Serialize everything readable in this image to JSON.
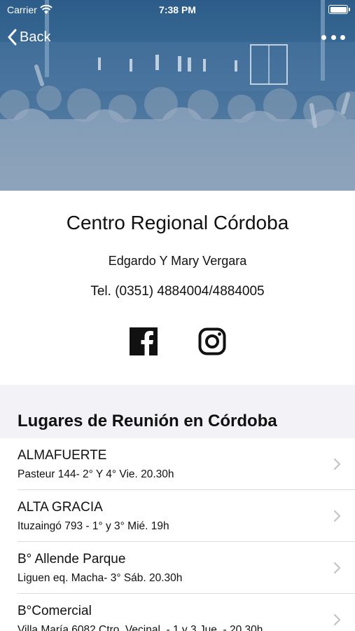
{
  "status_bar": {
    "carrier": "Carrier",
    "time": "7:38 PM"
  },
  "nav": {
    "back_label": "Back"
  },
  "church": {
    "name": "Centro Regional Córdoba",
    "pastors": "Edgardo Y Mary Vergara",
    "phone": "Tel. (0351) 4884004/4884005"
  },
  "social": {
    "facebook_icon": "facebook-icon",
    "instagram_icon": "instagram-icon"
  },
  "section": {
    "title": "Lugares de Reunión en Córdoba"
  },
  "meeting_places": [
    {
      "name": "ALMAFUERTE",
      "detail": "Pasteur 144- 2° Y 4° Vie. 20.30h"
    },
    {
      "name": "ALTA GRACIA",
      "detail": "Ituzaingó 793 - 1° y 3° Mié. 19h"
    },
    {
      "name": "B° Allende Parque",
      "detail": "Liguen eq. Macha- 3° Sáb. 20.30h"
    },
    {
      "name": "B°Comercial",
      "detail": " Villa María 6082 Ctro. Vecinal. - 1 y 3 Jue. - 20.30h"
    }
  ],
  "colors": {
    "hero_tint": "#3f6f99",
    "section_bg": "#f2f2f7",
    "chevron": "#c4c4c7"
  }
}
